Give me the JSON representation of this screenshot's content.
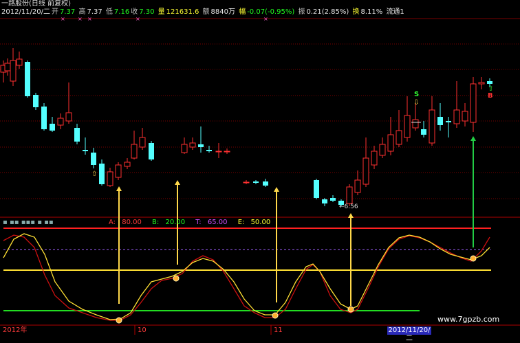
{
  "header": {
    "title": "一路股份(日线 前复权)",
    "date": "2012/11/20/二",
    "open_label": "开",
    "open": "7.37",
    "high_label": "高",
    "high": "7.37",
    "low_label": "低",
    "low": "7.16",
    "close_label": "收",
    "close": "7.30",
    "volume_label": "量",
    "volume": "121631.6",
    "amount_label": "额",
    "amount": "8840万",
    "change_label": "幅",
    "change": "-0.07(-0.95%)",
    "amplitude_label": "振",
    "amplitude": "0.21(2.85%)",
    "turnover_label": "换",
    "turnover": "8.11%",
    "float_label": "流通1"
  },
  "indicator": {
    "a_label": "A: ",
    "a_value": "80.00",
    "b_label": "B: ",
    "b_value": "20.00",
    "t_label": "T: ",
    "t_value": "65.00",
    "e_label": "E: ",
    "e_value": "50.00"
  },
  "axis": {
    "year_label": "2012年",
    "month_10": "10",
    "month_11": "11",
    "current_date": "2012/11/20/二"
  },
  "annotations": {
    "low_price": "←6.56",
    "sell_mark": "S",
    "buy_mark": "B"
  },
  "watermark": "www.7gpzb.com",
  "colors": {
    "up": "#ff3030",
    "down": "#54ffff",
    "line_upper": "#ff2020",
    "line_middle": "#ffe033",
    "line_lower": "#22dd22",
    "signal_arrow": "#ffd84a",
    "buy_arrow": "#22cc44"
  }
}
